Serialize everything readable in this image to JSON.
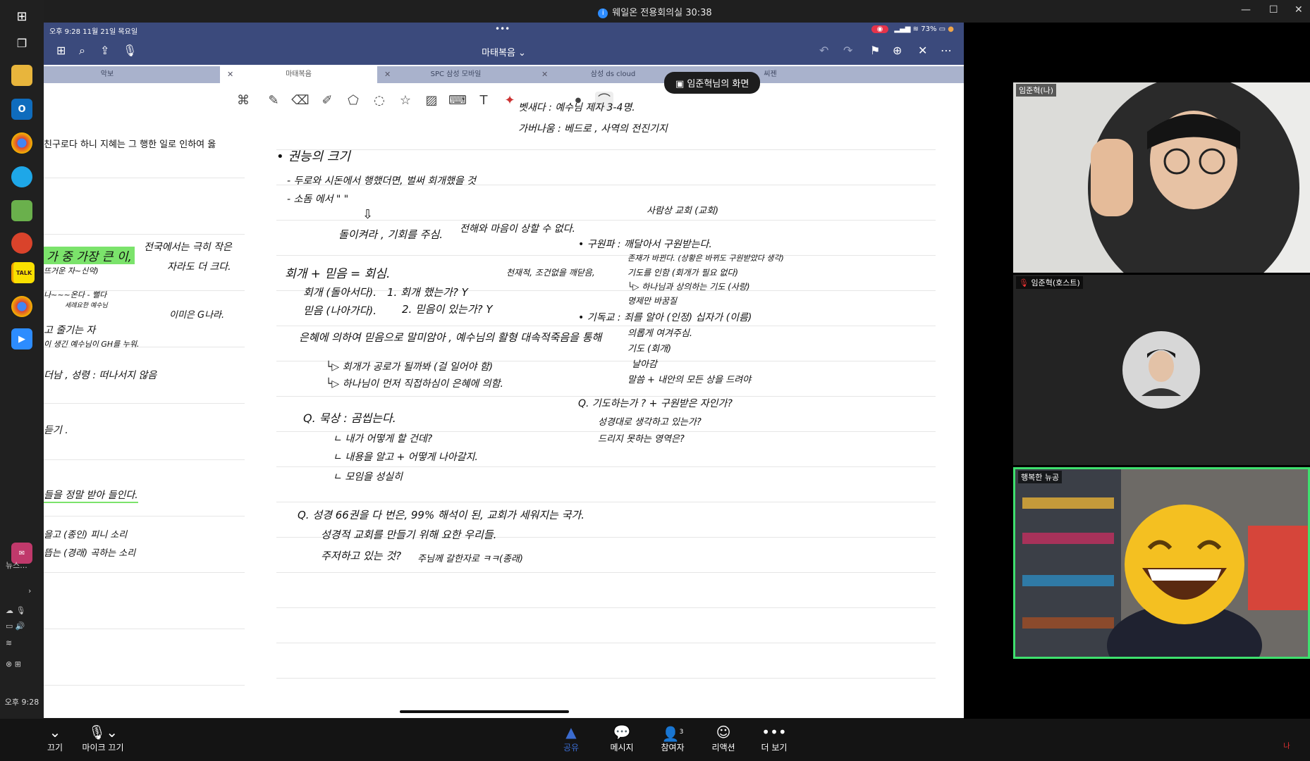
{
  "window": {
    "title": "웨일온 전용회의실 30:38",
    "info_icon": "i"
  },
  "taskbar": {
    "clock": "오후 9:28",
    "news_label": "뉴스...",
    "icons": [
      "windows-icon",
      "task-view-icon",
      "file-explorer-icon",
      "outlook-icon",
      "chrome-icon",
      "whale-icon",
      "notepad-icon",
      "app-icon",
      "kakaotalk-icon",
      "chrome-alt-icon",
      "zoom-icon"
    ],
    "kakao_label": "TALK",
    "notification_count": "2"
  },
  "ipad": {
    "status_left": "오후 9:28   11월 21일 목요일",
    "status_right": "73%",
    "doc_title": "마태복음 ⌄",
    "more_dots": "•••",
    "tabs": [
      {
        "label": "악보",
        "active": false
      },
      {
        "label": "마태복음",
        "active": true
      },
      {
        "label": "SPC 삼성 모바일",
        "active": false
      },
      {
        "label": "삼성 ds cloud",
        "active": false
      },
      {
        "label": "씨젠",
        "active": false
      }
    ],
    "screen_share_badge": "임준혁님의 화면"
  },
  "notes": {
    "left_lines": [
      "친구로다 하니 지혜는 그 행한 일로 인하여 옳",
      "가 중 가장 큰 이,",
      "뜨거운 자~신약)",
      "나~~~온다 - 뻘다",
      "세례요한 예수님",
      "고 줄기는 자",
      "이 생긴 예수님이 GH를 누워.",
      "더남 , 성령 : 떠나서지 않음",
      "듣기 .",
      "들을 정말 받아 들인다.",
      "을고 (종인) 피니 소리",
      "뜹는 (경래) 곡하는 소리"
    ],
    "left_side": [
      "전국에서는 극히 작은",
      "자라도 더 크다.",
      "이미은 G나라."
    ],
    "center_lines": [
      "• 권능의 크기",
      "- 두로와 시돈에서 행했더면, 벌써 회개했을 것",
      "- 소돔 에서 \"    \"",
      "돌이켜라 , 기회를 주심.",
      "전해와 마음이 상할 수 없다.",
      "회개 + 믿음 = 회심.",
      "회개 (돌아서다).",
      "믿음 (나아가다).",
      "1. 회개 했는가? Y",
      "2. 믿음이 있는가? Y",
      "천재적, 조건없을 깨닫음,",
      "은혜에 의하여 믿음으로 말미암아 , 예수님의 활형 대속적죽음을 통해",
      "└▷ 회개가 공로가 될까봐 (걸 일어야 함)",
      "└▷ 하나님이 먼저 직접하심이 은혜에 의함.",
      "Q. 묵상 : 곰씹는다.",
      "ㄴ 내가 어떻게 할 건데?",
      "ㄴ 내용을 알고 + 어떻게 나아갈지.",
      "ㄴ 모임을 성실히",
      "Q. 성경 66권을 다 번은, 99% 해석이 된, 교회가 세워지는 국가.",
      "성경적 교회를 만들기 위해 요한 우리들.",
      "주저하고 있는 것?",
      "주님께 갈한자로 ㅋㅋ(종래)"
    ],
    "right_lines": [
      "벳새다 : 예수님 제자 3-4명.",
      "가버나움 : 베드로 , 사역의 전진기지",
      "사람상 교회 (교회)",
      "• 구원파 : 깨달아서 구원받는다.",
      "존재가 바뀐다. (상황은 바뀌도 구원받았다 생각)",
      "기도를 인함 (회개가 필요 없다)",
      "└▷ 하나님과 상의하는 기도 (사랑)",
      "명제만 바꿈질",
      "• 기독교 : 죄를 알아 (인정) 십자가 (이름)",
      "의롭게 여겨주심.",
      "기도 (회개)",
      "날아감",
      "말씀 + 내안의 모든 상을 드려야",
      "Q. 기도하는가 ? + 구원받은 자인가?",
      "성경대로 생각하고 있는가?",
      "드리지 못하는 영역은?"
    ]
  },
  "participants": [
    {
      "name": "임준혁(나)"
    },
    {
      "name": "임준혁(호스트)"
    },
    {
      "name": "행복한 뉴공"
    }
  ],
  "zoom_bar": {
    "buttons": [
      {
        "label": "끄기",
        "icon": "video-icon"
      },
      {
        "label": "마이크 끄기",
        "icon": "mic-icon"
      },
      {
        "label": "공유",
        "icon": "share-icon"
      },
      {
        "label": "메시지",
        "icon": "chat-icon"
      },
      {
        "label": "참여자",
        "icon": "participants-icon",
        "badge": "3"
      },
      {
        "label": "리액션",
        "icon": "reaction-icon"
      },
      {
        "label": "더 보기",
        "icon": "more-icon"
      }
    ],
    "right_label": "나"
  },
  "colors": {
    "ipad_nav": "#3b4a7c",
    "highlight_green": "#7be36b",
    "accent_blue": "#2d8cff",
    "active_speaker": "#3ee06e"
  }
}
